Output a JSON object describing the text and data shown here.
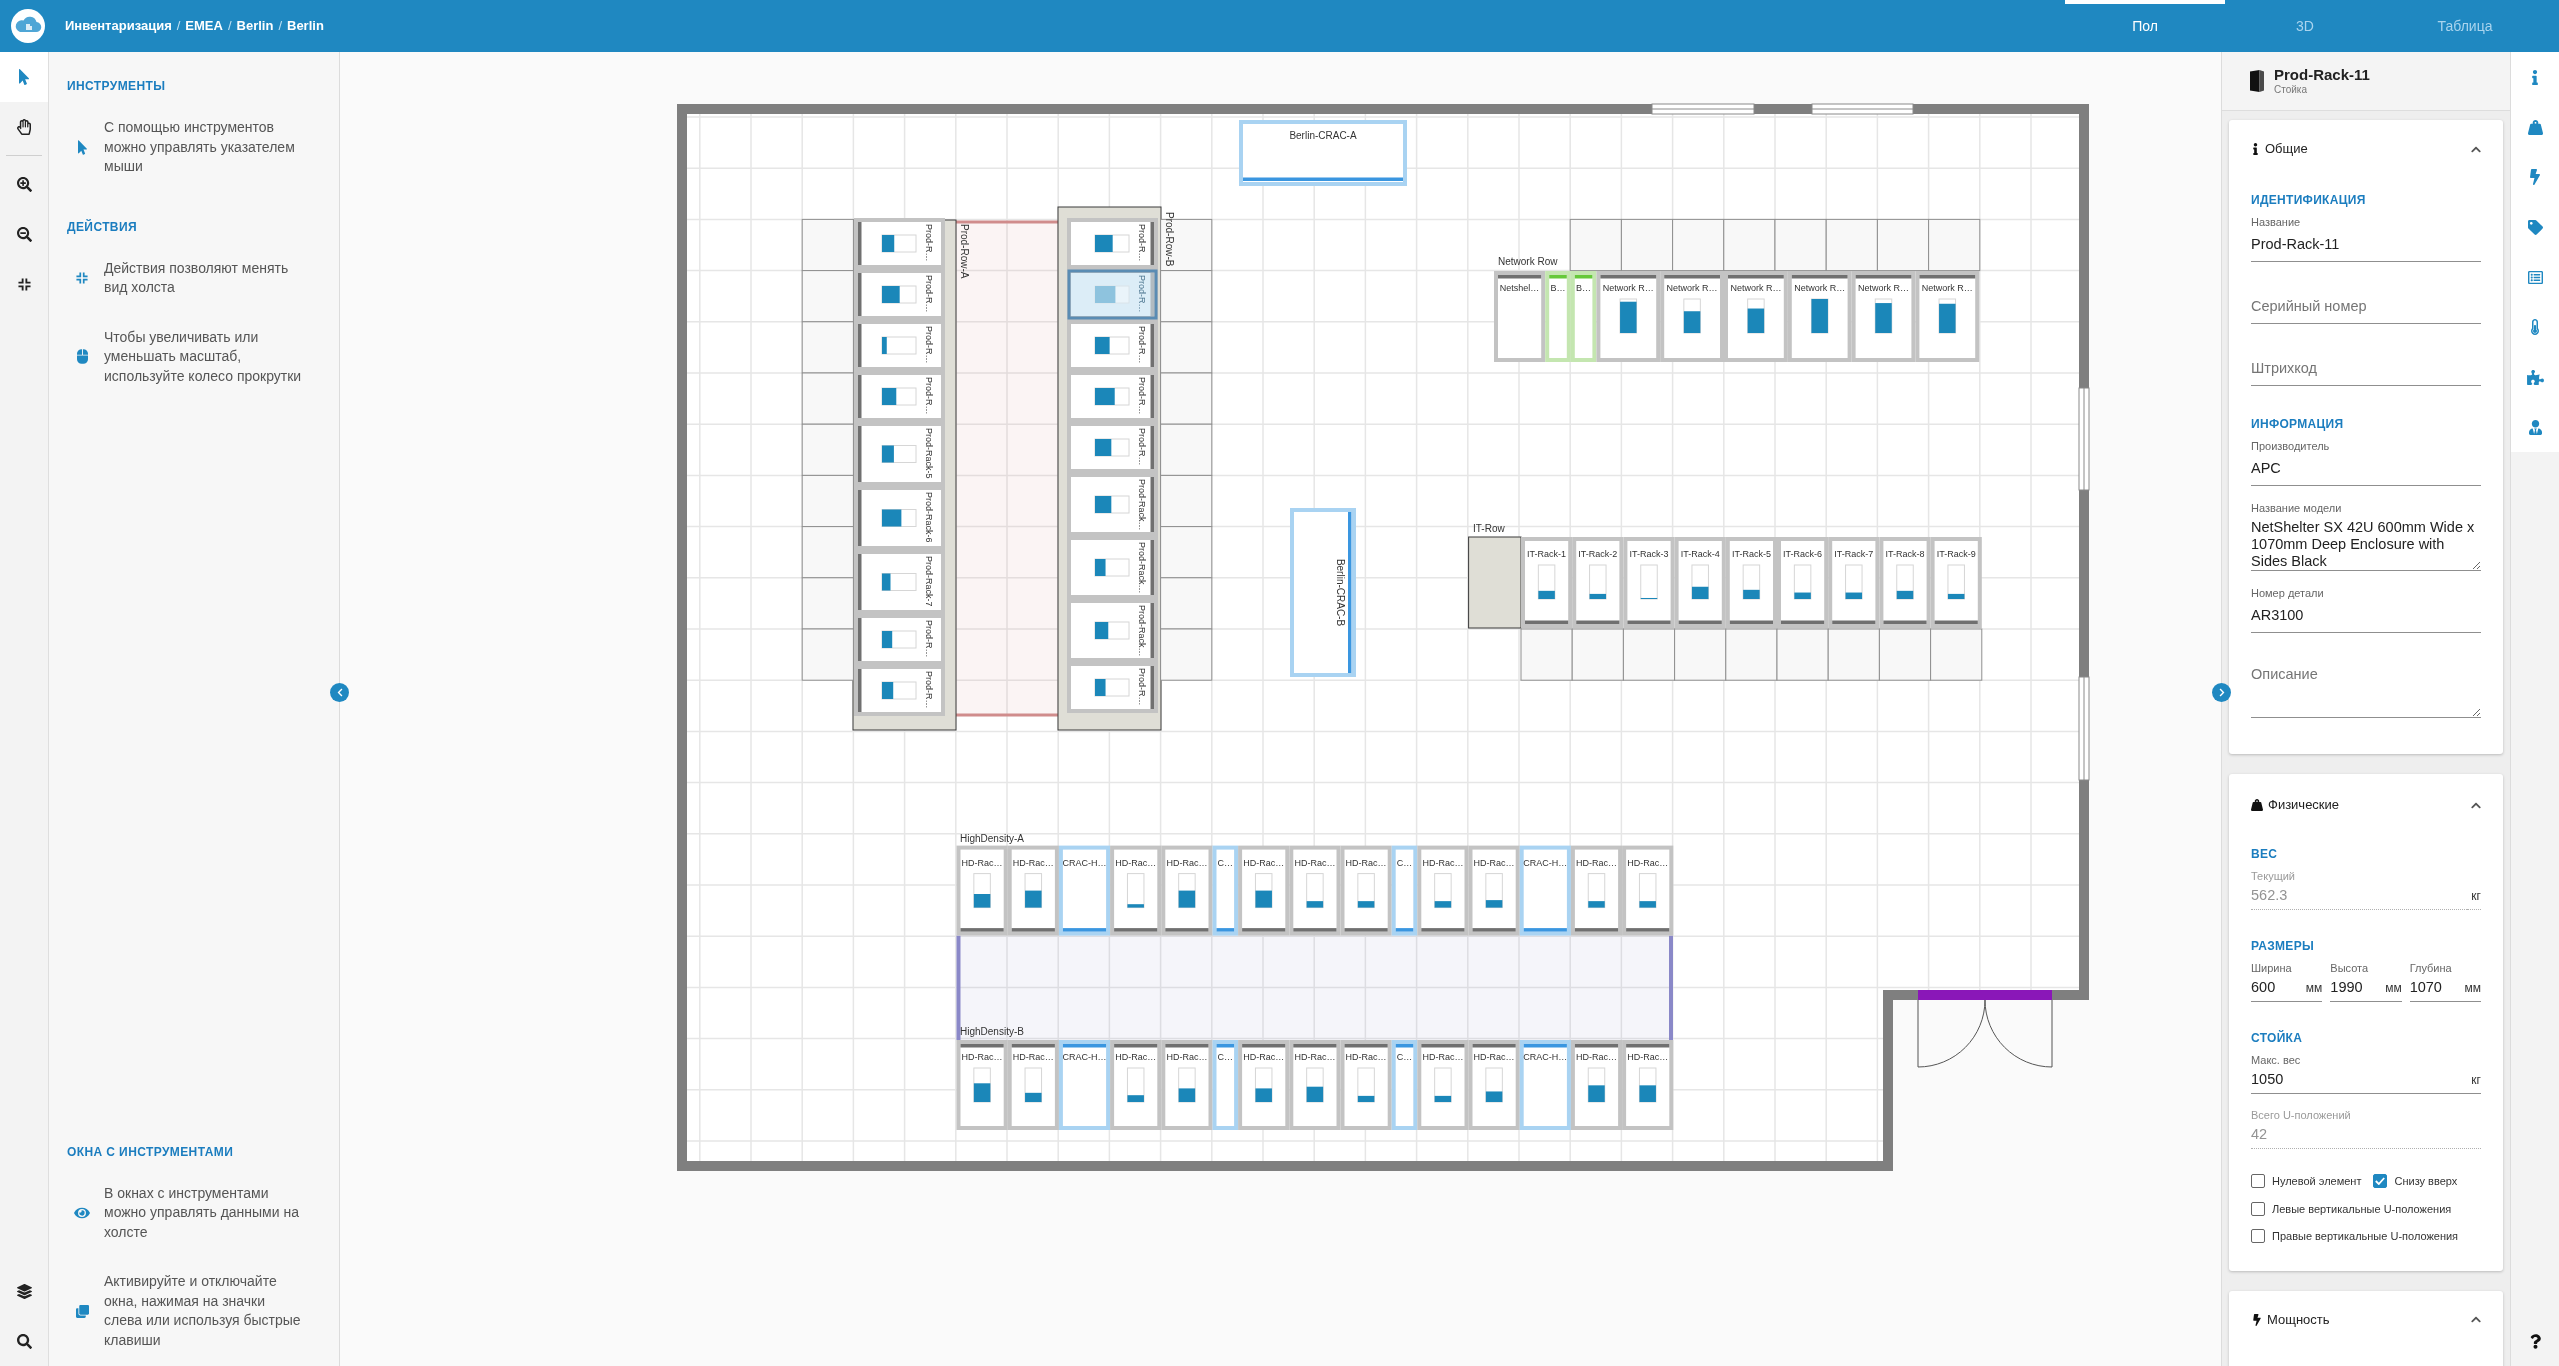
{
  "header": {
    "breadcrumb": {
      "items": [
        "Инвентаризация",
        "EMEA",
        "Berlin",
        "Berlin"
      ],
      "separator": "/"
    },
    "view_tabs": [
      {
        "label": "Пол",
        "selected": true
      },
      {
        "label": "3D",
        "selected": false
      },
      {
        "label": "Таблица",
        "selected": false
      }
    ]
  },
  "tool_rail": {
    "tools": [
      {
        "kind": "pointer",
        "selected": true
      },
      {
        "kind": "pan",
        "selected": false
      }
    ]
  },
  "help_panel": {
    "sections": [
      {
        "heading": "ИНСТРУМЕНТЫ",
        "items": [
          {
            "kind": "pointer",
            "text": "С помощью инструментов можно управлять указателем мыши"
          }
        ]
      },
      {
        "heading": "ДЕЙСТВИЯ",
        "items": [
          {
            "kind": "fit",
            "text": "Действия позволяют менять вид холста"
          },
          {
            "kind": "mouse",
            "text": "Чтобы увеличивать или уменьшать масштаб, используйте колесо прокрутки"
          }
        ]
      }
    ],
    "footer_section": {
      "heading": "ОКНА С ИНСТРУМЕНТАМИ",
      "items": [
        {
          "kind": "eye",
          "text": "В окнах с инструментами можно управлять данными на холсте"
        },
        {
          "kind": "windows",
          "text": "Активируйте и отключайте окна, нажимая на значки слева или используя быстрые клавиши"
        }
      ]
    }
  },
  "floor_plan": {
    "units": [
      {
        "name": "Berlin-CRAC-A",
        "selected": false
      },
      {
        "name": "Berlin-CRAC-B",
        "selected": false
      }
    ],
    "rows": [
      {
        "name": "Prod-Row-A",
        "items": [
          {
            "kind": "rack",
            "name": "Prod-R…",
            "level": 0.36,
            "selected": false
          },
          {
            "kind": "rack",
            "name": "Prod-R…",
            "level": 0.52,
            "selected": false
          },
          {
            "kind": "rack",
            "name": "Prod-R…",
            "level": 0.14,
            "selected": false
          },
          {
            "kind": "rack",
            "name": "Prod-R…",
            "level": 0.42,
            "selected": false
          },
          {
            "kind": "rack",
            "name": "Prod-Rack-5",
            "level": 0.35,
            "selected": false
          },
          {
            "kind": "rack",
            "name": "Prod-Rack-6",
            "level": 0.57,
            "selected": false
          },
          {
            "kind": "rack",
            "name": "Prod-Rack-7",
            "level": 0.25,
            "selected": false
          },
          {
            "kind": "rack",
            "name": "Prod-R…",
            "level": 0.3,
            "selected": false
          },
          {
            "kind": "rack",
            "name": "Prod-R…",
            "level": 0.33,
            "selected": false
          }
        ]
      },
      {
        "name": "Prod-Row-B",
        "items": [
          {
            "kind": "rack",
            "name": "Prod-R…",
            "level": 0.52,
            "selected": false
          },
          {
            "kind": "rack",
            "name": "Prod-R…",
            "level": 0.6,
            "selected": true
          },
          {
            "kind": "rack",
            "name": "Prod-R…",
            "level": 0.43,
            "selected": false
          },
          {
            "kind": "rack",
            "name": "Prod-R…",
            "level": 0.58,
            "selected": false
          },
          {
            "kind": "rack",
            "name": "Prod-R…",
            "level": 0.48,
            "selected": false
          },
          {
            "kind": "rack",
            "name": "Prod-Rack…",
            "level": 0.48,
            "selected": false
          },
          {
            "kind": "rack",
            "name": "Prod-Rack…",
            "level": 0.31,
            "selected": false
          },
          {
            "kind": "rack",
            "name": "Prod-Rack…",
            "level": 0.39,
            "selected": false
          },
          {
            "kind": "rack",
            "name": "Prod-R…",
            "level": 0.31,
            "selected": false
          }
        ]
      },
      {
        "name": "Network Row",
        "items": [
          {
            "kind": "enclosure",
            "name": "Netshel…",
            "selected": false
          },
          {
            "kind": "power",
            "name": "B…",
            "selected": false
          },
          {
            "kind": "power",
            "name": "B…",
            "selected": false
          },
          {
            "kind": "rack",
            "name": "Network R…",
            "level": 0.92,
            "selected": false
          },
          {
            "kind": "rack",
            "name": "Network R…",
            "level": 0.64,
            "selected": false
          },
          {
            "kind": "rack",
            "name": "Network R…",
            "level": 0.72,
            "selected": false
          },
          {
            "kind": "rack",
            "name": "Network R…",
            "level": 1,
            "selected": false
          },
          {
            "kind": "rack",
            "name": "Network R…",
            "level": 0.88,
            "selected": false
          },
          {
            "kind": "rack",
            "name": "Network R…",
            "level": 0.86,
            "selected": false
          }
        ]
      },
      {
        "name": "IT-Row",
        "items": [
          {
            "kind": "rack",
            "name": "IT-Rack-1",
            "level": 0.24,
            "selected": false
          },
          {
            "kind": "rack",
            "name": "IT-Rack-2",
            "level": 0.15,
            "selected": false
          },
          {
            "kind": "rack",
            "name": "IT-Rack-3",
            "level": 0.03,
            "selected": false
          },
          {
            "kind": "rack",
            "name": "IT-Rack-4",
            "level": 0.36,
            "selected": false
          },
          {
            "kind": "rack",
            "name": "IT-Rack-5",
            "level": 0.27,
            "selected": false
          },
          {
            "kind": "rack",
            "name": "IT-Rack-6",
            "level": 0.19,
            "selected": false
          },
          {
            "kind": "rack",
            "name": "IT-Rack-7",
            "level": 0.19,
            "selected": false
          },
          {
            "kind": "rack",
            "name": "IT-Rack-8",
            "level": 0.24,
            "selected": false
          },
          {
            "kind": "rack",
            "name": "IT-Rack-9",
            "level": 0.15,
            "selected": false
          }
        ]
      },
      {
        "name": "HighDensity-A",
        "items": [
          {
            "kind": "rack",
            "name": "HD-Rac…",
            "level": 0.4,
            "selected": false
          },
          {
            "kind": "rack",
            "name": "HD-Rac…",
            "level": 0.5,
            "selected": false
          },
          {
            "kind": "cooling",
            "name": "CRAC-H…",
            "selected": false
          },
          {
            "kind": "rack",
            "name": "HD-Rac…",
            "level": 0.1,
            "selected": false
          },
          {
            "kind": "rack",
            "name": "HD-Rac…",
            "level": 0.5,
            "selected": false
          },
          {
            "kind": "inrow_cooling",
            "name": "C…",
            "selected": false
          },
          {
            "kind": "rack",
            "name": "HD-Rac…",
            "level": 0.5,
            "selected": false
          },
          {
            "kind": "rack",
            "name": "HD-Rac…",
            "level": 0.19,
            "selected": false
          },
          {
            "kind": "rack",
            "name": "HD-Rac…",
            "level": 0.19,
            "selected": false
          },
          {
            "kind": "inrow_cooling",
            "name": "C…",
            "selected": false
          },
          {
            "kind": "rack",
            "name": "HD-Rac…",
            "level": 0.19,
            "selected": false
          },
          {
            "kind": "rack",
            "name": "HD-Rac…",
            "level": 0.22,
            "selected": false
          },
          {
            "kind": "cooling",
            "name": "CRAC-H…",
            "selected": false
          },
          {
            "kind": "rack",
            "name": "HD-Rac…",
            "level": 0.19,
            "selected": false
          },
          {
            "kind": "rack",
            "name": "HD-Rac…",
            "level": 0.19,
            "selected": false
          }
        ]
      },
      {
        "name": "HighDensity-B",
        "items": [
          {
            "kind": "rack",
            "name": "HD-Rac…",
            "level": 0.55,
            "selected": false
          },
          {
            "kind": "rack",
            "name": "HD-Rac…",
            "level": 0.27,
            "selected": false
          },
          {
            "kind": "cooling",
            "name": "CRAC-H…",
            "selected": false
          },
          {
            "kind": "rack",
            "name": "HD-Rac…",
            "level": 0.2,
            "selected": false
          },
          {
            "kind": "rack",
            "name": "HD-Rac…",
            "level": 0.4,
            "selected": false
          },
          {
            "kind": "inrow_cooling",
            "name": "C…",
            "selected": false
          },
          {
            "kind": "rack",
            "name": "HD-Rac…",
            "level": 0.4,
            "selected": false
          },
          {
            "kind": "rack",
            "name": "HD-Rac…",
            "level": 0.45,
            "selected": false
          },
          {
            "kind": "rack",
            "name": "HD-Rac…",
            "level": 0.18,
            "selected": false
          },
          {
            "kind": "inrow_cooling",
            "name": "C…",
            "selected": false
          },
          {
            "kind": "rack",
            "name": "HD-Rac…",
            "level": 0.18,
            "selected": false
          },
          {
            "kind": "rack",
            "name": "HD-Rac…",
            "level": 0.31,
            "selected": false
          },
          {
            "kind": "cooling",
            "name": "CRAC-H…",
            "selected": false
          },
          {
            "kind": "rack",
            "name": "HD-Rac…",
            "level": 0.49,
            "selected": false
          },
          {
            "kind": "rack",
            "name": "HD-Rac…",
            "level": 0.49,
            "selected": false
          }
        ]
      }
    ]
  },
  "properties_panel": {
    "title": "Prod-Rack-11",
    "subtitle": "Стойка",
    "sections": [
      {
        "kind": "general",
        "title": "Общие",
        "expanded": true,
        "groups": [
          {
            "kind": "stack",
            "heading": "ИДЕНТИФИКАЦИЯ",
            "fields": [
              {
                "kind": "text",
                "label": "Название",
                "value": "Prod-Rack-11",
                "disabled": false
              },
              {
                "kind": "text",
                "placeholder": "Серийный номер",
                "disabled": false
              },
              {
                "kind": "text",
                "placeholder": "Штрихкод",
                "disabled": false
              }
            ]
          },
          {
            "kind": "stack",
            "heading": "ИНФОРМАЦИЯ",
            "fields": [
              {
                "kind": "text",
                "label": "Производитель",
                "value": "APC",
                "disabled": false
              },
              {
                "kind": "multiline",
                "label": "Название модели",
                "value": "NetShelter SX 42U 600mm Wide x 1070mm Deep Enclosure with Sides Black",
                "disabled": false
              },
              {
                "kind": "text",
                "label": "Номер детали",
                "value": "AR3100",
                "disabled": false
              },
              {
                "kind": "multiline",
                "placeholder": "Описание",
                "disabled": false
              }
            ]
          }
        ]
      },
      {
        "kind": "physical",
        "title": "Физические",
        "expanded": true,
        "groups": [
          {
            "kind": "stack",
            "heading": "ВЕС",
            "fields": [
              {
                "kind": "text",
                "label": "Текущий",
                "value": "562.3",
                "unit": "кг",
                "disabled": true
              }
            ]
          },
          {
            "kind": "columns",
            "heading": "РАЗМЕРЫ",
            "fields": [
              {
                "kind": "text",
                "label": "Ширина",
                "value": "600",
                "unit": "мм",
                "disabled": false
              },
              {
                "kind": "text",
                "label": "Высота",
                "value": "1990",
                "unit": "мм",
                "disabled": false
              },
              {
                "kind": "text",
                "label": "Глубина",
                "value": "1070",
                "unit": "мм",
                "disabled": false
              }
            ]
          },
          {
            "kind": "stack",
            "heading": "СТОЙКА",
            "fields": [
              {
                "kind": "text",
                "label": "Макс. вес",
                "value": "1050",
                "unit": "кг",
                "disabled": false
              },
              {
                "kind": "text",
                "label": "Всего U-положений",
                "value": "42",
                "disabled": true
              }
            ],
            "checkboxes": [
              {
                "label": "Нулевой элемент",
                "checked": false
              },
              {
                "label": "Снизу вверх",
                "checked": true
              },
              {
                "label": "Левые вертикальные U-положения",
                "checked": false
              },
              {
                "label": "Правые вертикальные U-положения",
                "checked": false
              }
            ]
          }
        ]
      },
      {
        "kind": "power",
        "title": "Мощность",
        "expanded": true
      }
    ]
  }
}
